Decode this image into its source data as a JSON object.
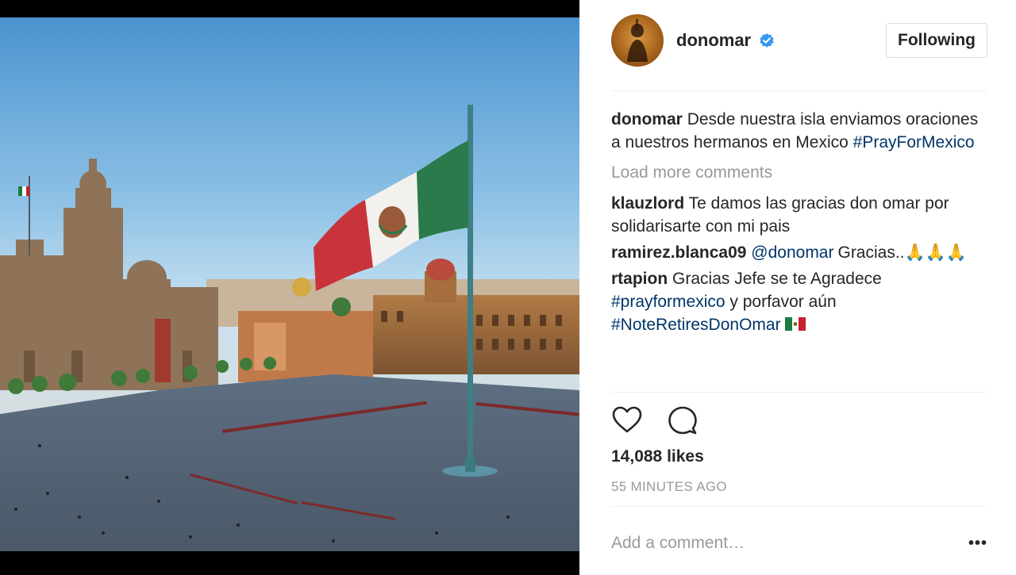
{
  "post": {
    "username": "donomar",
    "follow_button": "Following",
    "caption": {
      "user": "donomar",
      "text": "Desde nuestra isla enviamos oraciones a nuestros hermanos en Mexico",
      "hashtag": "#PrayForMexico"
    },
    "load_more": "Load more comments",
    "comments": [
      {
        "user": "klauzlord",
        "text": "Te damos las gracias don omar por solidarisarte con mi pais"
      },
      {
        "user": "ramirez.blanca09",
        "mention": "@donomar",
        "text": "Gracias..",
        "emoji": "🙏🙏🙏"
      },
      {
        "user": "rtapion",
        "text": "Gracias Jefe se te Agradece",
        "hashtag1": "#prayformexico",
        "text2": "y porfavor aún",
        "hashtag2": "#NoteRetiresDonOmar"
      }
    ],
    "likes": "14,088 likes",
    "time_ago": "55 MINUTES AGO",
    "add_comment_placeholder": "Add a comment…",
    "more_options": "•••"
  },
  "icons": {
    "verified": "verified-badge-icon",
    "like": "heart-icon",
    "comment": "comment-bubble-icon",
    "options": "more-options-icon"
  },
  "colors": {
    "hashtag": "#003569",
    "verified": "#3897f0",
    "muted": "#999999",
    "text": "#262626"
  }
}
